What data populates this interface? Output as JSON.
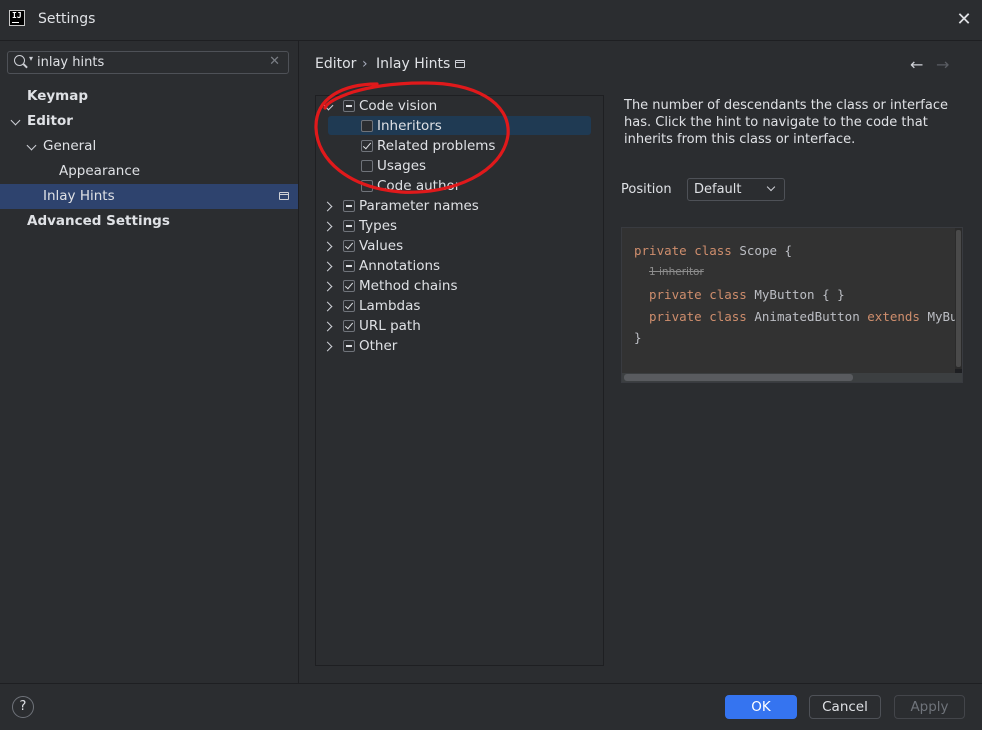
{
  "window": {
    "title": "Settings"
  },
  "search": {
    "value": "inlay hints"
  },
  "sidebar": {
    "items": [
      {
        "label": "Keymap"
      },
      {
        "label": "Editor"
      },
      {
        "label": "General"
      },
      {
        "label": "Appearance"
      },
      {
        "label": "Inlay Hints",
        "selected": true
      },
      {
        "label": "Advanced Settings"
      }
    ]
  },
  "breadcrumb": {
    "parent": "Editor",
    "separator": "›",
    "current": "Inlay Hints"
  },
  "nav_arrows": {
    "back": "←",
    "forward": "→"
  },
  "tree": {
    "items": [
      {
        "label": "Code vision",
        "state": "partial",
        "expanded": true
      },
      {
        "label": "Inheritors",
        "state": "unchecked",
        "selected": true
      },
      {
        "label": "Related problems",
        "state": "checked"
      },
      {
        "label": "Usages",
        "state": "unchecked"
      },
      {
        "label": "Code author",
        "state": "unchecked"
      },
      {
        "label": "Parameter names",
        "state": "partial"
      },
      {
        "label": "Types",
        "state": "partial"
      },
      {
        "label": "Values",
        "state": "checked"
      },
      {
        "label": "Annotations",
        "state": "partial"
      },
      {
        "label": "Method chains",
        "state": "checked"
      },
      {
        "label": "Lambdas",
        "state": "checked"
      },
      {
        "label": "URL path",
        "state": "checked"
      },
      {
        "label": "Other",
        "state": "partial"
      }
    ]
  },
  "description": "The number of descendants the class or interface has. Click the hint to navigate to the code that inherits from this class or interface.",
  "position": {
    "label": "Position",
    "value": "Default"
  },
  "preview": {
    "line1_kw": "private class",
    "line1_rest": " Scope {",
    "hint": "1 inheritor",
    "line2_kw": "private class",
    "line2_rest": " MyButton { }",
    "line3_kw": "private class",
    "line3_mid": " AnimatedButton ",
    "line3_kw2": "extends",
    "line3_rest": " MyButton",
    "line4": "}"
  },
  "footer": {
    "help": "?",
    "ok": "OK",
    "cancel": "Cancel",
    "apply": "Apply"
  },
  "colors": {
    "accent": "#3574f0",
    "selection": "#2e436e",
    "annotation": "#e0191b",
    "keyword": "#cf8e6d"
  }
}
